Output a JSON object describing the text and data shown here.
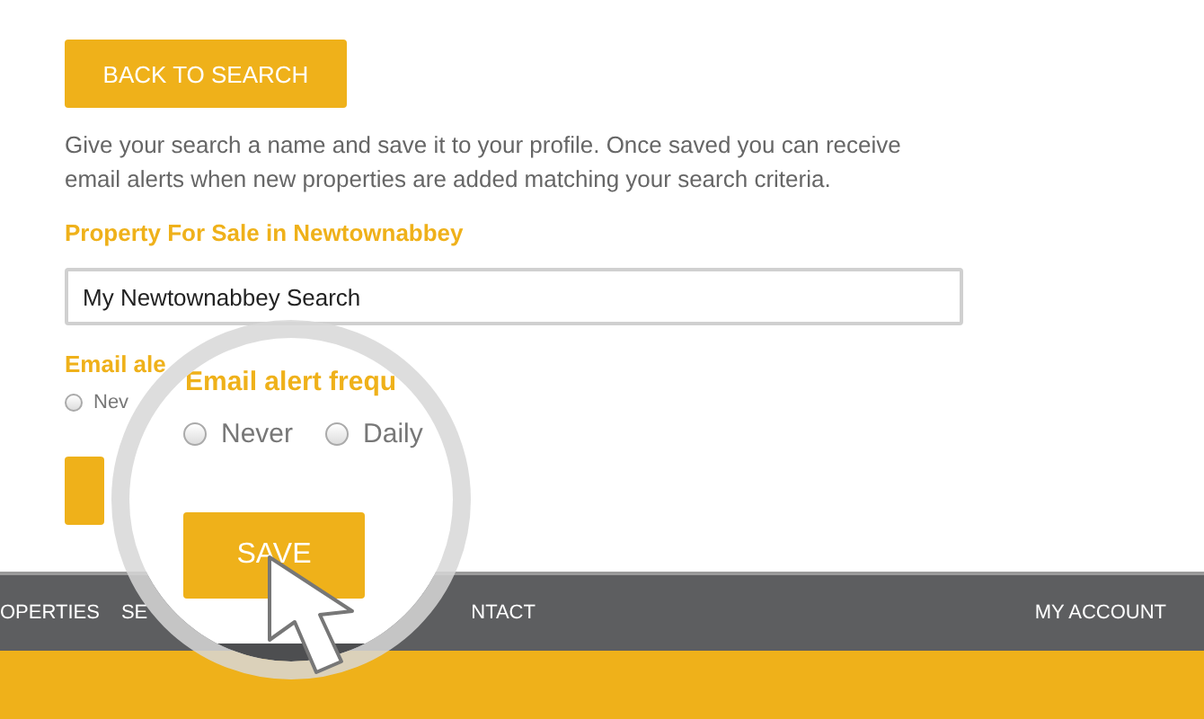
{
  "back_button": "BACK TO SEARCH",
  "intro": "Give your search a name and save it to your profile. Once saved you can receive email alerts when new properties are added matching your search criteria.",
  "search_title": "Property For Sale in Newtownabbey",
  "search_name": {
    "value": "My Newtownabbey Search"
  },
  "alert_label": "Email ale",
  "alert_options": [
    {
      "label": "Nev",
      "selected": false
    }
  ],
  "nav": {
    "items": [
      {
        "label": "OPERTIES"
      },
      {
        "label": "SE"
      },
      {
        "label": "NTACT"
      }
    ],
    "account": "MY ACCOUNT"
  },
  "magnifier": {
    "heading": "Email alert frequ",
    "options": [
      {
        "label": "Never",
        "selected": false
      },
      {
        "label": "Daily",
        "selected": false
      }
    ],
    "save_button": "SAVE"
  }
}
